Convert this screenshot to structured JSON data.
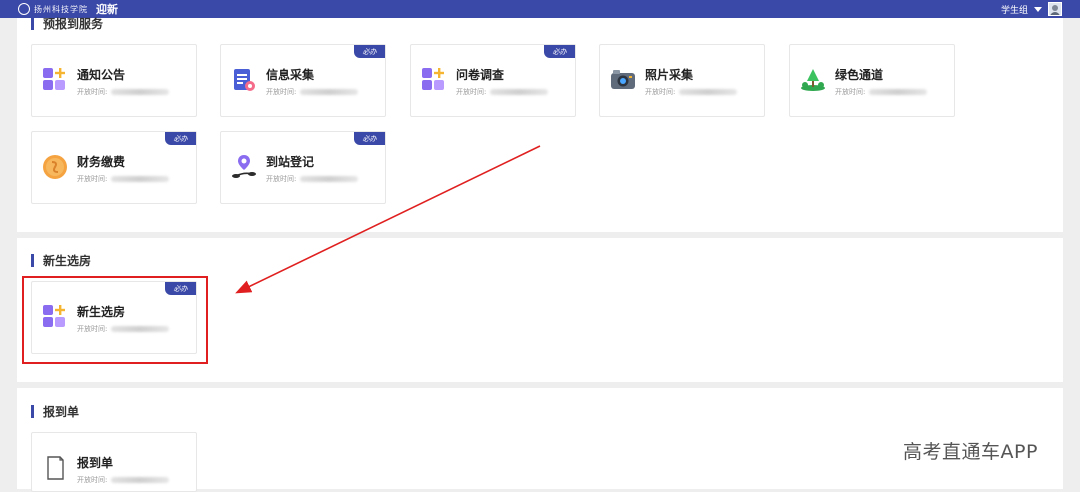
{
  "topbar": {
    "logo_text": "扬州科技学院",
    "app_title": "迎新",
    "user_label": "学生组"
  },
  "sections": {
    "pre_register": {
      "title": "预报到服务",
      "cards": [
        {
          "name": "通知公告",
          "time_label": "开放时间:",
          "required": false
        },
        {
          "name": "信息采集",
          "time_label": "开放时间:",
          "required": true,
          "badge": "必办"
        },
        {
          "name": "问卷调查",
          "time_label": "开放时间:",
          "required": true,
          "badge": "必办"
        },
        {
          "name": "照片采集",
          "time_label": "开放时间:",
          "required": false
        },
        {
          "name": "绿色通道",
          "time_label": "开放时间:",
          "required": false
        },
        {
          "name": "财务缴费",
          "time_label": "开放时间:",
          "required": true,
          "badge": "必办"
        },
        {
          "name": "到站登记",
          "time_label": "开放时间:",
          "required": true,
          "badge": "必办"
        }
      ]
    },
    "dorm": {
      "title": "新生选房",
      "cards": [
        {
          "name": "新生选房",
          "time_label": "开放时间:",
          "required": true,
          "badge": "必办"
        }
      ]
    },
    "report": {
      "title": "报到单",
      "cards": [
        {
          "name": "报到单",
          "time_label": "开放时间:",
          "required": false
        }
      ]
    }
  },
  "watermark": "高考直通车APP",
  "colors": {
    "accent": "#3a48a8",
    "annotation": "#e02020"
  },
  "icons": {
    "notice": "apps-plus-icon",
    "info": "clipboard-form-icon",
    "survey": "apps-plus-icon",
    "photo": "camera-icon",
    "green": "tree-icon",
    "finance": "coin-icon",
    "arrival": "location-route-icon",
    "dorm": "apps-plus-icon",
    "report": "document-icon"
  }
}
